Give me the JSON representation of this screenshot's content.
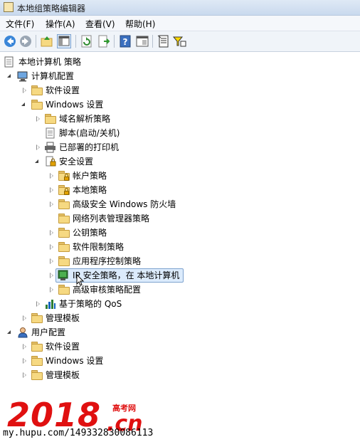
{
  "window": {
    "title": "本地组策略编辑器"
  },
  "menu": [
    {
      "label": "文件(F)"
    },
    {
      "label": "操作(A)"
    },
    {
      "label": "查看(V)"
    },
    {
      "label": "帮助(H)"
    }
  ],
  "toolbar": {
    "buttons": [
      "back-icon",
      "forward-icon",
      "up-folder-icon",
      "show-hide-tree-icon",
      "refresh-icon",
      "export-list-icon",
      "help-icon",
      "properties-view-icon",
      "policy-document-icon",
      "filter-icon"
    ]
  },
  "tree": {
    "root": "本地计算机 策略",
    "computer_config": "计算机配置",
    "software_settings": "软件设置",
    "windows_settings": "Windows 设置",
    "name_resolution_policy": "域名解析策略",
    "scripts": "脚本(启动/关机)",
    "deployed_printers": "已部署的打印机",
    "security_settings": "安全设置",
    "account_policies": "帐户策略",
    "local_policies": "本地策略",
    "firewall": "高级安全 Windows 防火墙",
    "network_list": "网络列表管理器策略",
    "public_key": "公钥策略",
    "software_restriction": "软件限制策略",
    "app_control": "应用程序控制策略",
    "ip_security": "IP 安全策略，在 本地计算机",
    "advanced_audit": "高级审核策略配置",
    "qos": "基于策略的 QoS",
    "admin_templates": "管理模板",
    "user_config": "用户配置",
    "user_software_settings": "软件设置",
    "user_windows_settings": "Windows 设置",
    "user_admin_templates": "管理模板"
  },
  "watermark": {
    "logo": "2018",
    "domain": ".cn",
    "sub": "高考网",
    "url": "my.hupu.com/149332830086113"
  },
  "colors": {
    "selection": "#dcebfc",
    "watermark": "#e01010"
  }
}
